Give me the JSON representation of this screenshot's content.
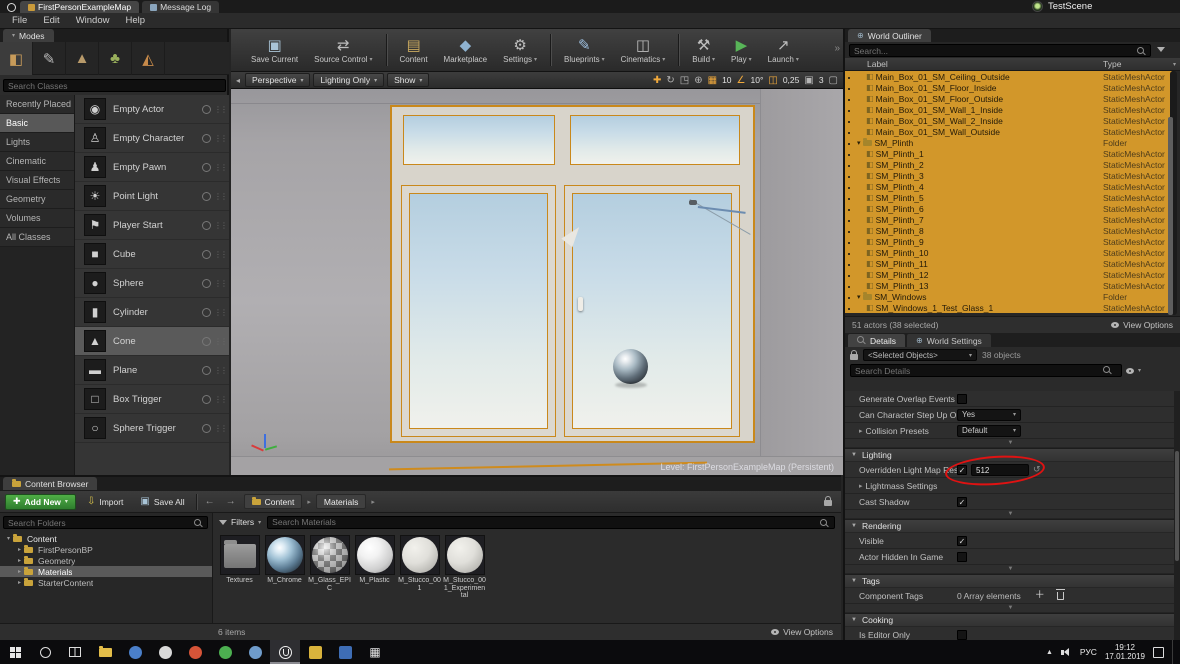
{
  "annotation": {
    "shape": "ellipse",
    "color": "#e01212",
    "target": "Overridden Light Map Res value"
  },
  "title_bar": {
    "tabs": [
      {
        "label": "FirstPersonExampleMap",
        "active": true
      },
      {
        "label": "Message Log",
        "active": false
      }
    ],
    "project_name": "TestScene"
  },
  "menu_bar": {
    "items": [
      "File",
      "Edit",
      "Window",
      "Help"
    ]
  },
  "modes_panel": {
    "tab_label": "Modes",
    "tools": [
      {
        "name": "place-mode-icon",
        "glyph": "◧",
        "color": "#c79b5a",
        "selected": true
      },
      {
        "name": "paint-mode-icon",
        "glyph": "✎",
        "color": "#b8b8b8",
        "selected": false
      },
      {
        "name": "landscape-mode-icon",
        "glyph": "▲",
        "color": "#b89a6a",
        "selected": false
      },
      {
        "name": "foliage-mode-icon",
        "glyph": "♣",
        "color": "#9ab05c",
        "selected": false
      },
      {
        "name": "geometry-mode-icon",
        "glyph": "◭",
        "color": "#c78a4a",
        "selected": false
      }
    ],
    "search_placeholder": "Search Classes",
    "categories": [
      {
        "label": "Recently Placed",
        "selected": false
      },
      {
        "label": "Basic",
        "selected": true
      },
      {
        "label": "Lights",
        "selected": false
      },
      {
        "label": "Cinematic",
        "selected": false
      },
      {
        "label": "Visual Effects",
        "selected": false
      },
      {
        "label": "Geometry",
        "selected": false
      },
      {
        "label": "Volumes",
        "selected": false
      },
      {
        "label": "All Classes",
        "selected": false
      }
    ],
    "items": [
      {
        "label": "Empty Actor",
        "glyph": "◉",
        "selected": false
      },
      {
        "label": "Empty Character",
        "glyph": "♙",
        "selected": false
      },
      {
        "label": "Empty Pawn",
        "glyph": "♟",
        "selected": false
      },
      {
        "label": "Point Light",
        "glyph": "☀",
        "selected": false
      },
      {
        "label": "Player Start",
        "glyph": "⚑",
        "selected": false
      },
      {
        "label": "Cube",
        "glyph": "■",
        "selected": false
      },
      {
        "label": "Sphere",
        "glyph": "●",
        "selected": false
      },
      {
        "label": "Cylinder",
        "glyph": "▮",
        "selected": false
      },
      {
        "label": "Cone",
        "glyph": "▲",
        "selected": true
      },
      {
        "label": "Plane",
        "glyph": "▬",
        "selected": false
      },
      {
        "label": "Box Trigger",
        "glyph": "□",
        "selected": false
      },
      {
        "label": "Sphere Trigger",
        "glyph": "○",
        "selected": false
      }
    ]
  },
  "main_toolbar": {
    "buttons": [
      {
        "label": "Save Current",
        "icon": "save-icon",
        "glyph": "▣",
        "color": "#a9c4d7",
        "dropdown": false,
        "separator_after": false
      },
      {
        "label": "Source Control",
        "icon": "source-control-icon",
        "glyph": "⇄",
        "color": "#bdbdbd",
        "dropdown": true,
        "separator_after": true
      },
      {
        "label": "Content",
        "icon": "content-browser-icon",
        "glyph": "▤",
        "color": "#c9a95f",
        "dropdown": false,
        "separator_after": false
      },
      {
        "label": "Marketplace",
        "icon": "marketplace-icon",
        "glyph": "◆",
        "color": "#8fb3d1",
        "dropdown": false,
        "separator_after": false
      },
      {
        "label": "Settings",
        "icon": "settings-gear-icon",
        "glyph": "⚙",
        "color": "#bdbdbd",
        "dropdown": true,
        "separator_after": true
      },
      {
        "label": "Blueprints",
        "icon": "blueprints-icon",
        "glyph": "✎",
        "color": "#9fc0e0",
        "dropdown": true,
        "separator_after": false
      },
      {
        "label": "Cinematics",
        "icon": "cinematics-icon",
        "glyph": "◫",
        "color": "#bdbdbd",
        "dropdown": true,
        "separator_after": true
      },
      {
        "label": "Build",
        "icon": "build-hammer-icon",
        "glyph": "⚒",
        "color": "#bdbdbd",
        "dropdown": true,
        "separator_after": false
      },
      {
        "label": "Play",
        "icon": "play-icon",
        "glyph": "▶",
        "color": "#58b558",
        "dropdown": true,
        "separator_after": false
      },
      {
        "label": "Launch",
        "icon": "launch-icon",
        "glyph": "↗",
        "color": "#bdbdbd",
        "dropdown": true,
        "separator_after": false
      }
    ]
  },
  "viewport": {
    "toolbar": {
      "perspective": "Perspective",
      "view_mode": "Lighting Only",
      "show": "Show",
      "grid_snap": "10",
      "rotation_snap": "10°",
      "scale_snap": "0,25",
      "camera_speed": "3"
    },
    "level_label": "Level: FirstPersonExampleMap (Persistent)"
  },
  "world_outliner": {
    "tab_label": "World Outliner",
    "search_placeholder": "Search...",
    "columns": {
      "label": "Label",
      "type": "Type"
    },
    "rows": [
      {
        "label": "Main_Box_01_SM_Ceiling_Outside",
        "type": "StaticMeshActor",
        "kind": "mesh",
        "indent": 1,
        "selected": true
      },
      {
        "label": "Main_Box_01_SM_Floor_Inside",
        "type": "StaticMeshActor",
        "kind": "mesh",
        "indent": 1,
        "selected": true
      },
      {
        "label": "Main_Box_01_SM_Floor_Outside",
        "type": "StaticMeshActor",
        "kind": "mesh",
        "indent": 1,
        "selected": true
      },
      {
        "label": "Main_Box_01_SM_Wall_1_Inside",
        "type": "StaticMeshActor",
        "kind": "mesh",
        "indent": 1,
        "selected": true
      },
      {
        "label": "Main_Box_01_SM_Wall_2_Inside",
        "type": "StaticMeshActor",
        "kind": "mesh",
        "indent": 1,
        "selected": true
      },
      {
        "label": "Main_Box_01_SM_Wall_Outside",
        "type": "StaticMeshActor",
        "kind": "mesh",
        "indent": 1,
        "selected": true
      },
      {
        "label": "SM_Plinth",
        "type": "Folder",
        "kind": "folder",
        "indent": 0,
        "selected": true
      },
      {
        "label": "SM_Plinth_1",
        "type": "StaticMeshActor",
        "kind": "mesh",
        "indent": 1,
        "selected": true
      },
      {
        "label": "SM_Plinth_2",
        "type": "StaticMeshActor",
        "kind": "mesh",
        "indent": 1,
        "selected": true
      },
      {
        "label": "SM_Plinth_3",
        "type": "StaticMeshActor",
        "kind": "mesh",
        "indent": 1,
        "selected": true
      },
      {
        "label": "SM_Plinth_4",
        "type": "StaticMeshActor",
        "kind": "mesh",
        "indent": 1,
        "selected": true
      },
      {
        "label": "SM_Plinth_5",
        "type": "StaticMeshActor",
        "kind": "mesh",
        "indent": 1,
        "selected": true
      },
      {
        "label": "SM_Plinth_6",
        "type": "StaticMeshActor",
        "kind": "mesh",
        "indent": 1,
        "selected": true
      },
      {
        "label": "SM_Plinth_7",
        "type": "StaticMeshActor",
        "kind": "mesh",
        "indent": 1,
        "selected": true
      },
      {
        "label": "SM_Plinth_8",
        "type": "StaticMeshActor",
        "kind": "mesh",
        "indent": 1,
        "selected": true
      },
      {
        "label": "SM_Plinth_9",
        "type": "StaticMeshActor",
        "kind": "mesh",
        "indent": 1,
        "selected": true
      },
      {
        "label": "SM_Plinth_10",
        "type": "StaticMeshActor",
        "kind": "mesh",
        "indent": 1,
        "selected": true
      },
      {
        "label": "SM_Plinth_11",
        "type": "StaticMeshActor",
        "kind": "mesh",
        "indent": 1,
        "selected": true
      },
      {
        "label": "SM_Plinth_12",
        "type": "StaticMeshActor",
        "kind": "mesh",
        "indent": 1,
        "selected": true
      },
      {
        "label": "SM_Plinth_13",
        "type": "StaticMeshActor",
        "kind": "mesh",
        "indent": 1,
        "selected": true
      },
      {
        "label": "SM_Windows",
        "type": "Folder",
        "kind": "folder",
        "indent": 0,
        "selected": true
      },
      {
        "label": "SM_Windows_1_Test_Glass_1",
        "type": "StaticMeshActor",
        "kind": "mesh",
        "indent": 1,
        "selected": true
      }
    ],
    "status": "51 actors (38 selected)",
    "view_options_label": "View Options"
  },
  "details_panel": {
    "tabs": [
      {
        "label": "Details",
        "active": true
      },
      {
        "label": "World Settings",
        "active": false
      }
    ],
    "selected_objects_label": "<Selected Objects>",
    "objects_count": "38 objects",
    "search_placeholder": "Search Details",
    "rows": [
      {
        "kind": "prop",
        "label": "Generate Overlap Events",
        "control": "checkbox",
        "checked": false
      },
      {
        "kind": "prop",
        "label": "Can Character Step Up On",
        "control": "dropdown",
        "value": "Yes"
      },
      {
        "kind": "prop",
        "label": "Collision Presets",
        "control": "dropdown",
        "value": "Default",
        "expander": true
      },
      {
        "kind": "advanced"
      },
      {
        "kind": "section",
        "label": "Lighting"
      },
      {
        "kind": "prop",
        "label": "Overridden Light Map Res",
        "control": "check-input",
        "checked": true,
        "value": "512",
        "annotated": true
      },
      {
        "kind": "prop",
        "label": "Lightmass Settings",
        "control": "none",
        "expander": true
      },
      {
        "kind": "prop",
        "label": "Cast Shadow",
        "control": "checkbox",
        "checked": true
      },
      {
        "kind": "advanced"
      },
      {
        "kind": "section",
        "label": "Rendering"
      },
      {
        "kind": "prop",
        "label": "Visible",
        "control": "checkbox",
        "checked": true
      },
      {
        "kind": "prop",
        "label": "Actor Hidden In Game",
        "control": "checkbox",
        "checked": false
      },
      {
        "kind": "advanced"
      },
      {
        "kind": "section",
        "label": "Tags"
      },
      {
        "kind": "prop",
        "label": "Component Tags",
        "control": "array",
        "value": "0 Array elements"
      },
      {
        "kind": "advanced"
      },
      {
        "kind": "section",
        "label": "Cooking"
      },
      {
        "kind": "prop",
        "label": "Is Editor Only",
        "control": "checkbox",
        "checked": false
      }
    ]
  },
  "content_browser": {
    "tab_label": "Content Browser",
    "toolbar": {
      "add_new": "Add New",
      "import": "Import",
      "save_all": "Save All"
    },
    "breadcrumb": [
      "Content",
      "Materials"
    ],
    "folder_search_placeholder": "Search Folders",
    "folder_tree": [
      {
        "label": "Content",
        "indent": 0,
        "expanded": true,
        "selected": false
      },
      {
        "label": "FirstPersonBP",
        "indent": 1,
        "expanded": false,
        "selected": false
      },
      {
        "label": "Geometry",
        "indent": 1,
        "expanded": false,
        "selected": false
      },
      {
        "label": "Materials",
        "indent": 1,
        "expanded": false,
        "selected": true
      },
      {
        "label": "StarterContent",
        "indent": 1,
        "expanded": false,
        "selected": false
      }
    ],
    "filters_label": "Filters",
    "asset_search_placeholder": "Search Materials",
    "assets": [
      {
        "label": "Textures",
        "kind": "folder"
      },
      {
        "label": "M_Chrome",
        "kind": "chrome"
      },
      {
        "label": "M_Glass_EPIC",
        "kind": "glass"
      },
      {
        "label": "M_Plastic",
        "kind": "plastic"
      },
      {
        "label": "M_Stucco_001",
        "kind": "stucco"
      },
      {
        "label": "M_Stucco_001_Experimental",
        "kind": "stucco"
      }
    ],
    "status": "6 items",
    "view_options_label": "View Options"
  },
  "taskbar": {
    "icons": [
      {
        "name": "start-button",
        "kind": "win"
      },
      {
        "name": "search-button",
        "kind": "circle"
      },
      {
        "name": "task-view-button",
        "kind": "taskview"
      },
      {
        "name": "file-explorer-icon",
        "kind": "folder"
      },
      {
        "name": "app-icon-1",
        "kind": "dot",
        "color": "#4a7fc9"
      },
      {
        "name": "app-icon-2",
        "kind": "dot",
        "color": "#d8d8d8"
      },
      {
        "name": "app-icon-3",
        "kind": "dot",
        "color": "#d65438"
      },
      {
        "name": "app-icon-4",
        "kind": "dot",
        "color": "#4caf50"
      },
      {
        "name": "app-icon-5",
        "kind": "dot",
        "color": "#6f9ccb"
      },
      {
        "name": "unreal-editor-icon",
        "kind": "unreal",
        "highlighted": true
      },
      {
        "name": "app-icon-6",
        "kind": "square",
        "color": "#d9b33c"
      },
      {
        "name": "app-icon-7",
        "kind": "square",
        "color": "#3e6db5"
      },
      {
        "name": "app-icon-8",
        "kind": "grid",
        "color": "#e0e0e0"
      }
    ],
    "tray": {
      "language": "РУС",
      "time": "19:12",
      "date": "17.01.2019"
    }
  }
}
